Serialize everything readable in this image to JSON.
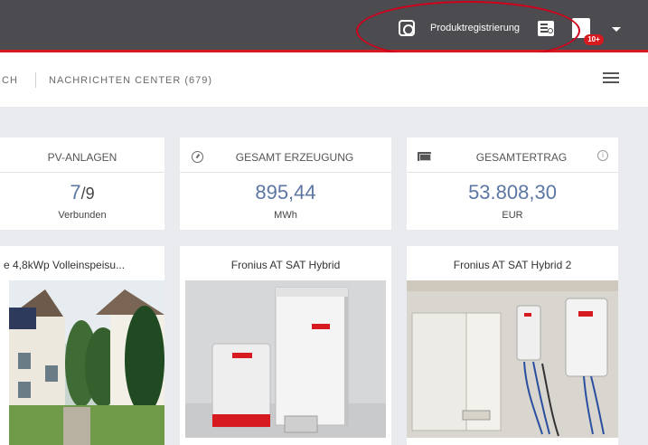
{
  "header": {
    "product_registration_label": "Produktregistrierung",
    "notification_badge": "10+",
    "accent_color": "#d71920",
    "bar_color": "#4b4b50",
    "icons": [
      "help-icon",
      "register-icon",
      "notification-icon",
      "chevron-down-icon"
    ]
  },
  "subnav": {
    "partial_left": "CH",
    "message_center": "NACHRICHTEN CENTER (679)",
    "menu_icon": "list-icon"
  },
  "stats": [
    {
      "title": "PV-ANLAGEN",
      "value_connected": "7",
      "value_total": "/9",
      "subtitle": "Verbunden"
    },
    {
      "title": "GESAMT ERZEUGUNG",
      "value": "895,44",
      "subtitle": "MWh",
      "icon": "gauge-icon"
    },
    {
      "title": "GESAMTERTRAG",
      "value": "53.808,30",
      "subtitle": "EUR",
      "icon": "money-icon",
      "info_icon": "info-icon"
    }
  ],
  "systems": [
    {
      "title": "e 4,8kWp Volleinspeisu..."
    },
    {
      "title": "Fronius AT SAT Hybrid"
    },
    {
      "title": "Fronius AT SAT Hybrid 2"
    }
  ],
  "colors": {
    "stat_value": "#5c77a3",
    "page_bg": "#e9ebee"
  }
}
